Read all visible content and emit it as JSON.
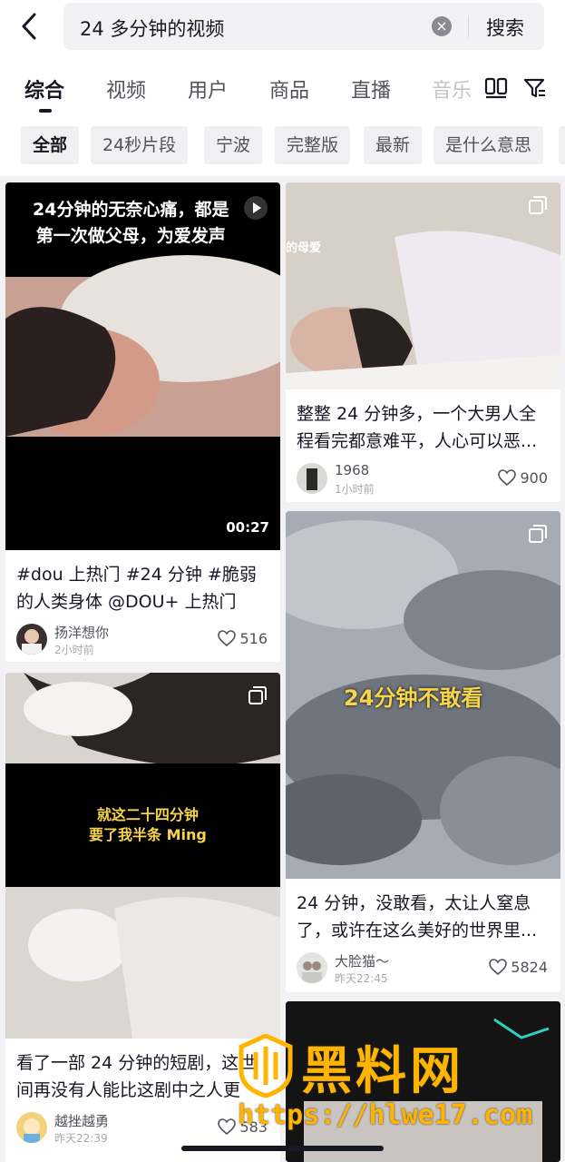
{
  "search": {
    "query": "24 多分钟的视频",
    "clear_symbol": "×",
    "button_label": "搜索"
  },
  "tabs": [
    {
      "label": "综合",
      "active": true
    },
    {
      "label": "视频"
    },
    {
      "label": "用户"
    },
    {
      "label": "商品"
    },
    {
      "label": "直播"
    },
    {
      "label": "音乐"
    }
  ],
  "chips": [
    "全部",
    "24秒片段",
    "宁波",
    "完整版",
    "最新",
    "是什么意思"
  ],
  "cards": [
    {
      "overlay": "24分钟的无奈心痛，都是\n第一次做父母，为爱发声",
      "duration": "00:27",
      "caption": "#dou 上热门 #24 分钟 #脆弱的人类身体 @DOU+ 上热门 @D...",
      "author": "扬洋想你",
      "time": "2小时前",
      "likes": "516"
    },
    {
      "overlay": "就这二十四分钟\n要了我半条 Ming",
      "caption": "看了一部 24 分钟的短剧，这世间再没有人能比这剧中之人更",
      "author": "越挫越勇",
      "time": "昨天22:39",
      "likes": "583"
    },
    {
      "overlay": "的母爱",
      "caption": "整整 24 分钟多，一个大男人全程看完都意难平，人心可以恶...",
      "author": "1968",
      "time": "1小时前",
      "likes": "900"
    },
    {
      "overlay": "24分钟不敢看",
      "caption": "24 分钟，没敢看，太让人窒息了，或许在这么美好的世界里...",
      "author": "大脸猫～",
      "time": "昨天22:45",
      "likes": "5824"
    }
  ],
  "watermark": {
    "title": "黑料网",
    "url": "https://hlwe17.com"
  }
}
